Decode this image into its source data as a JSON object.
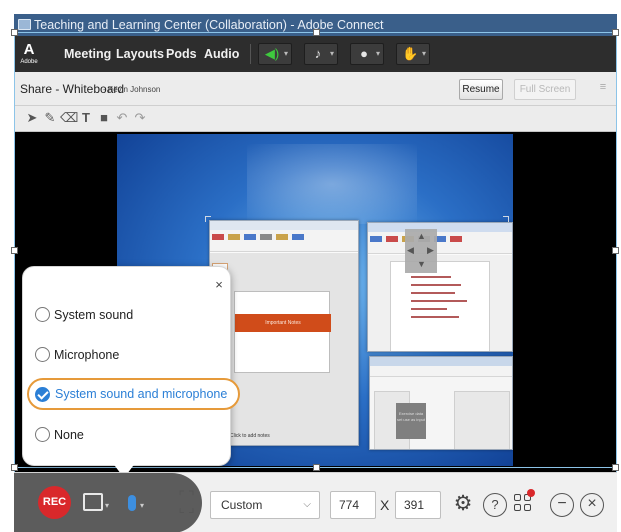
{
  "window": {
    "title": "Teaching and Learning Center (Collaboration) - Adobe Connect"
  },
  "menubar": {
    "logo_text": "A",
    "logo_sub": "Adobe",
    "items": [
      "Meeting",
      "Layouts",
      "Pods",
      "Audio"
    ],
    "toolbar_icons": [
      "speaker-icon",
      "microphone-icon",
      "webcam-icon",
      "raise-hand-icon"
    ]
  },
  "pod": {
    "title": "Share - Whiteboard",
    "presenter": "- Kevin Johnson",
    "resume_label": "Resume",
    "fullscreen_label": "Full Screen"
  },
  "whiteboard_tools": [
    "select-arrow-icon",
    "pencil-icon",
    "eraser-icon",
    "text-tool-icon",
    "shape-tool-icon",
    "undo-icon",
    "redo-icon"
  ],
  "shared_screen": {
    "slide_title": "Important Notes",
    "slide_footer": "Click to add notes",
    "dialog_box_text": "Exercise data set use as input"
  },
  "audio_popup": {
    "close_glyph": "×",
    "options": [
      {
        "label": "System sound",
        "selected": false
      },
      {
        "label": "Microphone",
        "selected": false
      },
      {
        "label": "System sound and microphone",
        "selected": true
      },
      {
        "label": "None",
        "selected": false
      }
    ]
  },
  "recording_toolbar": {
    "rec_label": "REC",
    "preset_value": "Custom",
    "width_value": "774",
    "times_glyph": "X",
    "height_value": "391",
    "help_glyph": "?",
    "minimize_glyph": "−",
    "close_glyph": "×",
    "accent_color": "#d9282b",
    "mic_color": "#3d8fe0"
  }
}
